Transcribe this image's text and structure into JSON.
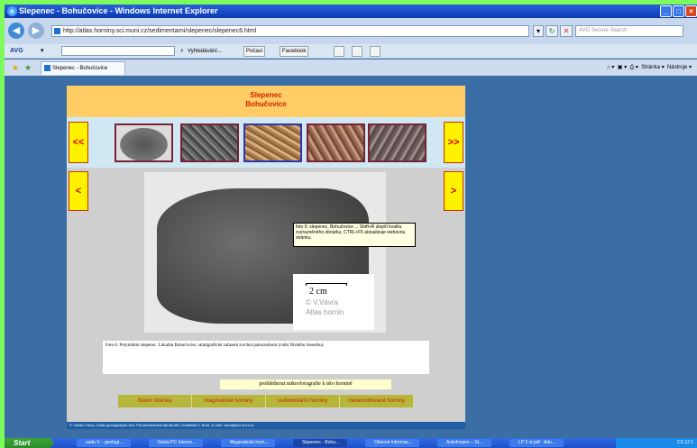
{
  "window": {
    "title": "Slepenec - Bohučovice - Windows Internet Explorer",
    "minimize": "_",
    "maximize": "□",
    "close": "×"
  },
  "address": {
    "url": "http://atlas.horniny.sci.muni.cz/sedimentarni/slepenec/slepenec6.html",
    "search_placeholder": "AVG Secure Search"
  },
  "avg_toolbar": {
    "brand": "AVG",
    "search_label": "Vyhledávání...",
    "btn_pocasi": "Počasí",
    "btn_facebook": "Facebook"
  },
  "tab": {
    "label": "Slepenec - Bohučovice"
  },
  "tools": {
    "stranka": "Stránka",
    "nastroje": "Nástroje"
  },
  "page": {
    "title_line1": "Slepenec",
    "title_line2": "Bohučovice",
    "nav_prev_all": "<<",
    "nav_next_all": ">>",
    "nav_prev": "<",
    "nav_next": ">",
    "scale_text": "2 cm",
    "credit_line1": "© V.Vávra",
    "credit_line2": "Atlas hornin",
    "tooltip": "foto 6: slepenec, Bohučovice ... Shift+R zlepší kvalitu zvýrazněného obrázku, CTRL+F5 aktualizuje webovou stránku.",
    "caption": "Foto 6. Polymiktní slepenec. Lokalita Bohučovice, stratigrafické zařazení svrchní paleozoikum (culm Nízkého Jeseníku).",
    "mikro_link": "prohlédnout mikrofotografie k této hornině",
    "menu": [
      "hlavní stránka",
      "magmatické horniny",
      "sedimentární horniny",
      "metamorfované horniny"
    ],
    "footer": "© Václav Vávra, Ústav geologických věd, Přírodovědecká fakulta MU, Kotlářská 2, Brno. E-mail: vavra@sci.muni.cz"
  },
  "taskbar": {
    "start": "Start",
    "items": [
      "sada V. - geologi...",
      "Nokia PC Interne...",
      "Magmatické horn...",
      "Slepenec - Bohu...",
      "Obecné informac...",
      "ActivInspire – St...",
      "LP 2 st.pdf - Ado..."
    ],
    "tray": "CS 12:1"
  },
  "colors": {
    "header_bg": "#ffcc66",
    "title_red": "#cc2200",
    "nav_yellow": "#fff200",
    "menu_olive": "#b6b63a",
    "page_bg": "#3a6ea5"
  }
}
